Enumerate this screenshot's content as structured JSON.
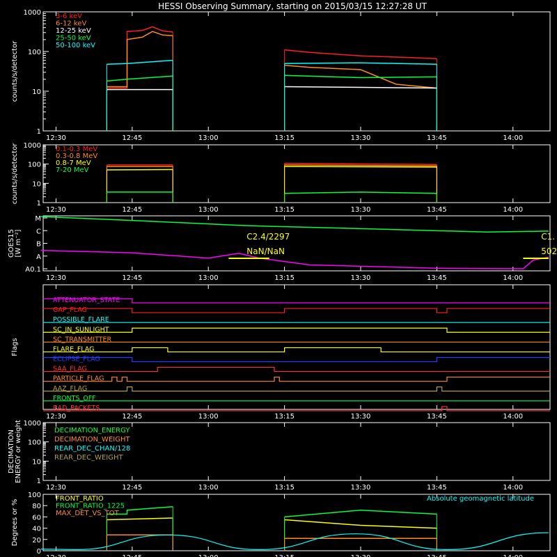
{
  "title": "HESSI Observing Summary, starting on 2015/03/15 12:27:28 UT",
  "colors": {
    "bg": "#000000",
    "axis": "#ffffff",
    "red": "#ff2020",
    "orange": "#ff8c1a",
    "white": "#ffffff",
    "yellow": "#ffff00",
    "green": "#00ff40",
    "cyan": "#00ffff",
    "magenta": "#ff00ff",
    "blue": "#2040ff",
    "darkred": "#ff3030",
    "olive": "#b0a040"
  },
  "time_ticks": [
    "12:30",
    "12:45",
    "13:00",
    "13:15",
    "13:30",
    "13:45",
    "14:00"
  ],
  "chart_data": [
    {
      "id": "panel1",
      "type": "line",
      "ylabel": "counts/s/detector",
      "yscale": "log",
      "ylim": [
        1,
        1000
      ],
      "yticks": [
        "1",
        "10",
        "100",
        "1000"
      ],
      "legend_placement": "top-left",
      "series": [
        {
          "name": "3-6 keV",
          "color": "red",
          "segments": [
            [
              [
                "12:40",
                12
              ],
              [
                "12:44",
                12
              ],
              [
                "12:44",
                320
              ],
              [
                "12:47",
                340
              ],
              [
                "12:49",
                420
              ],
              [
                "12:51",
                330
              ],
              [
                "12:53",
                310
              ]
            ],
            [
              [
                "13:15",
                110
              ],
              [
                "13:20",
                95
              ],
              [
                "13:30",
                78
              ],
              [
                "13:40",
                70
              ],
              [
                "13:45",
                66
              ]
            ]
          ]
        },
        {
          "name": "6-12 keV",
          "color": "orange",
          "segments": [
            [
              [
                "12:40",
                13
              ],
              [
                "12:44",
                13
              ],
              [
                "12:44",
                200
              ],
              [
                "12:47",
                230
              ],
              [
                "12:49",
                320
              ],
              [
                "12:51",
                260
              ],
              [
                "12:53",
                250
              ]
            ],
            [
              [
                "13:15",
                45
              ],
              [
                "13:20",
                40
              ],
              [
                "13:30",
                35
              ],
              [
                "13:37",
                15
              ],
              [
                "13:45",
                12
              ]
            ]
          ]
        },
        {
          "name": "12-25 keV",
          "color": "white",
          "segments": [
            [
              [
                "12:40",
                11
              ],
              [
                "12:53",
                11
              ]
            ],
            [
              [
                "13:15",
                13
              ],
              [
                "13:45",
                12
              ]
            ]
          ]
        },
        {
          "name": "25-50 keV",
          "color": "green",
          "segments": [
            [
              [
                "12:40",
                18
              ],
              [
                "12:44",
                20
              ],
              [
                "12:53",
                24
              ]
            ],
            [
              [
                "13:15",
                25
              ],
              [
                "13:30",
                22
              ],
              [
                "13:45",
                23
              ]
            ]
          ]
        },
        {
          "name": "50-100 keV",
          "color": "cyan",
          "segments": [
            [
              [
                "12:40",
                48
              ],
              [
                "12:44",
                50
              ],
              [
                "12:53",
                60
              ]
            ],
            [
              [
                "13:15",
                50
              ],
              [
                "13:30",
                52
              ],
              [
                "13:45",
                48
              ]
            ]
          ]
        }
      ]
    },
    {
      "id": "panel2",
      "type": "line",
      "ylabel": "counts/s/detector",
      "yscale": "log",
      "ylim": [
        1,
        1000
      ],
      "yticks": [
        "1",
        "10",
        "100",
        "1000"
      ],
      "legend_placement": "top-left",
      "series": [
        {
          "name": "0.1-0.3 MeV",
          "color": "red",
          "segments": [
            [
              [
                "12:40",
                90
              ],
              [
                "12:53",
                90
              ]
            ],
            [
              [
                "13:15",
                110
              ],
              [
                "13:45",
                95
              ]
            ]
          ]
        },
        {
          "name": "0.3-0.8 MeV",
          "color": "orange",
          "segments": [
            [
              [
                "12:40",
                75
              ],
              [
                "12:53",
                75
              ]
            ],
            [
              [
                "13:15",
                90
              ],
              [
                "13:45",
                80
              ]
            ]
          ]
        },
        {
          "name": "0.8-7 MeV",
          "color": "yellow",
          "segments": [
            [
              [
                "12:40",
                50
              ],
              [
                "12:53",
                52
              ]
            ],
            [
              [
                "13:15",
                75
              ],
              [
                "13:45",
                70
              ]
            ]
          ]
        },
        {
          "name": "7-20 MeV",
          "color": "green",
          "segments": [
            [
              [
                "12:40",
                3.5
              ],
              [
                "12:53",
                3.5
              ]
            ],
            [
              [
                "13:15",
                3
              ],
              [
                "13:30",
                3.5
              ],
              [
                "13:45",
                3
              ]
            ]
          ]
        }
      ]
    },
    {
      "id": "panel3",
      "type": "line",
      "ylabel": "GOES15",
      "ylabel2": "[W m⁻²]",
      "yticks": [
        "A0.1",
        "A",
        "B",
        "C",
        "M"
      ],
      "series": [
        {
          "color": "green",
          "points": [
            [
              "12:27",
              5.4
            ],
            [
              "12:45",
              5.0
            ],
            [
              "13:06",
              4.5
            ],
            [
              "13:12",
              4.4
            ],
            [
              "13:30",
              4.15
            ],
            [
              "13:55",
              3.8
            ],
            [
              "14:07",
              3.9
            ]
          ]
        },
        {
          "color": "magenta",
          "points": [
            [
              "12:27",
              1.9
            ],
            [
              "12:45",
              1.65
            ],
            [
              "13:00",
              1.1
            ],
            [
              "13:06",
              1.6
            ],
            [
              "13:10",
              1.1
            ],
            [
              "13:20",
              0.4
            ],
            [
              "13:45",
              0.05
            ],
            [
              "14:00",
              0.0
            ],
            [
              "14:02",
              0.0
            ],
            [
              "14:04",
              0.9
            ],
            [
              "14:07",
              1.2
            ]
          ]
        }
      ],
      "annotations": [
        {
          "text": "C2.4/2297",
          "t": "13:07",
          "v": 2.4,
          "color": "yellow"
        },
        {
          "text": "NaN/NaN",
          "t": "13:07",
          "v": 0.7,
          "color": "yellow"
        },
        {
          "text": "C1.",
          "t": "14:05",
          "v": 2.4,
          "color": "yellow"
        },
        {
          "text": "502",
          "t": "14:05",
          "v": 0.7,
          "color": "yellow"
        }
      ],
      "bars": [
        {
          "t0": "13:04",
          "t1": "13:12",
          "v": 0.0,
          "color": "yellow"
        },
        {
          "t0": "14:02",
          "t1": "14:07",
          "v": 0.0,
          "color": "yellow"
        }
      ]
    },
    {
      "id": "panel4",
      "type": "line",
      "ylabel": "Flags",
      "rows": [
        {
          "name": "ATTENUATOR_STATE",
          "color": "magenta",
          "steps": [
            [
              "12:27",
              1
            ],
            [
              "12:45",
              0
            ]
          ]
        },
        {
          "name": "GAP_FLAG",
          "color": "red",
          "steps": [
            [
              "12:27",
              1
            ],
            [
              "12:45",
              0
            ],
            [
              "13:15",
              1
            ],
            [
              "13:45",
              0
            ],
            [
              "13:47",
              1
            ]
          ]
        },
        {
          "name": "POSSIBLE_FLARE",
          "color": "cyan",
          "steps": [
            [
              "12:27",
              0
            ]
          ]
        },
        {
          "name": "SC_IN_SUNLIGHT",
          "color": "yellow",
          "steps": [
            [
              "12:27",
              0
            ],
            [
              "12:45",
              1
            ],
            [
              "13:47",
              0
            ]
          ]
        },
        {
          "name": "SC_TRANSMITTER",
          "color": "orange",
          "steps": [
            [
              "12:27",
              0
            ]
          ]
        },
        {
          "name": "FLARE_FLAG",
          "color": "yellow",
          "steps": [
            [
              "12:27",
              0
            ],
            [
              "12:45",
              1
            ],
            [
              "12:52",
              0
            ],
            [
              "13:15",
              1
            ],
            [
              "13:34",
              0
            ]
          ]
        },
        {
          "name": "ECLIPSE_FLAG",
          "color": "blue",
          "steps": [
            [
              "12:27",
              1
            ],
            [
              "12:45",
              0
            ],
            [
              "13:45",
              1
            ]
          ]
        },
        {
          "name": "SAA_FLAG",
          "color": "darkred",
          "steps": [
            [
              "12:27",
              0
            ],
            [
              "12:50",
              1
            ],
            [
              "13:13",
              0
            ]
          ]
        },
        {
          "name": "PARTICLE_FLAG",
          "color": "orange",
          "steps": [
            [
              "12:27",
              0
            ],
            [
              "12:41",
              1
            ],
            [
              "12:42",
              0
            ],
            [
              "12:43",
              1
            ],
            [
              "12:44",
              0
            ],
            [
              "13:13",
              1
            ],
            [
              "13:14",
              0
            ],
            [
              "13:47",
              1
            ]
          ]
        },
        {
          "name": "AAZ_FLAG",
          "color": "olive",
          "steps": [
            [
              "12:27",
              0
            ],
            [
              "12:44",
              1
            ],
            [
              "12:45",
              0
            ],
            [
              "13:45",
              1
            ],
            [
              "13:46",
              0
            ]
          ]
        },
        {
          "name": "FRONTS_OFF",
          "color": "green",
          "steps": [
            [
              "12:27",
              0
            ]
          ]
        },
        {
          "name": "BAD_PACKETS",
          "color": "darkred",
          "steps": [
            [
              "12:27",
              0
            ],
            [
              "13:46",
              1
            ],
            [
              "13:47",
              0
            ]
          ]
        }
      ]
    },
    {
      "id": "panel5",
      "type": "line",
      "ylabel": "DECIMATION",
      "ylabel2": "ENERGY or weight",
      "yscale": "log",
      "ylim": [
        1,
        1000
      ],
      "yticks": [
        "1",
        "10",
        "100",
        "1000"
      ],
      "legend_placement": "top-left",
      "series": [
        {
          "name": "DECIMATION_ENERGY",
          "color": "green",
          "points": []
        },
        {
          "name": "DECIMATION_WEIGHT",
          "color": "orange",
          "points": []
        },
        {
          "name": "REAR_DEC_CHAN/128",
          "color": "cyan",
          "points": []
        },
        {
          "name": "REAR_DEC_WEIGHT",
          "color": "olive",
          "points": []
        }
      ]
    },
    {
      "id": "panel6",
      "type": "line",
      "ylabel": "Degrees or %",
      "ylim": [
        0,
        100
      ],
      "yticks": [
        "0",
        "20",
        "40",
        "60",
        "80",
        "100"
      ],
      "legend_placement": "top-left",
      "annotation": "Absolute geomagnetic latitude",
      "series": [
        {
          "name": "FRONT_RATIO",
          "color": "yellow",
          "segments": [
            [
              [
                "12:40",
                55
              ],
              [
                "12:53",
                58
              ]
            ],
            [
              [
                "13:15",
                55
              ],
              [
                "13:30",
                45
              ],
              [
                "13:45",
                40
              ]
            ]
          ]
        },
        {
          "name": "FRONT_RATIO_1225",
          "color": "green",
          "segments": [
            [
              [
                "12:40",
                65
              ],
              [
                "12:44",
                65
              ],
              [
                "12:44",
                72
              ],
              [
                "12:53",
                78
              ]
            ],
            [
              [
                "13:15",
                60
              ],
              [
                "13:30",
                72
              ],
              [
                "13:45",
                65
              ]
            ]
          ]
        },
        {
          "name": "MAX_DET_VS_TOT",
          "color": "orange",
          "segments": [
            [
              [
                "12:40",
                28
              ],
              [
                "12:53",
                28
              ]
            ],
            [
              [
                "13:15",
                22
              ],
              [
                "13:45",
                22
              ]
            ]
          ]
        },
        {
          "name": "",
          "color": "cyan",
          "points": [
            [
              "12:27",
              3
            ],
            [
              "12:34",
              2
            ],
            [
              "12:52",
              28
            ],
            [
              "13:10",
              2
            ],
            [
              "13:29",
              30
            ],
            [
              "13:47",
              2
            ],
            [
              "14:07",
              32
            ]
          ]
        }
      ]
    }
  ]
}
